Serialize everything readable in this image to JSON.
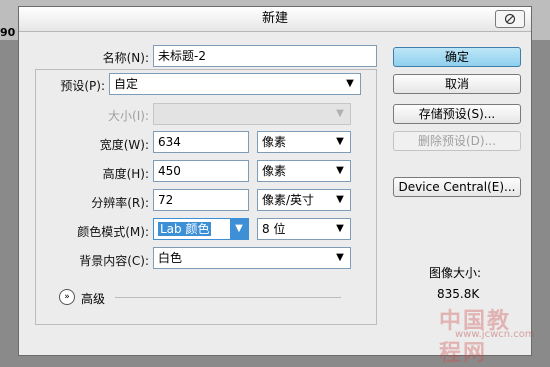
{
  "background": {
    "ruler_number": "90"
  },
  "dialog": {
    "title": "新建",
    "title_button_icon": "no-entry-icon",
    "name": {
      "label": "名称(N):",
      "value": "未标题-2"
    },
    "preset": {
      "label": "预设(P):",
      "value": "自定"
    },
    "size": {
      "label": "大小(I):",
      "value": ""
    },
    "width": {
      "label": "宽度(W):",
      "value": "634",
      "unit": "像素"
    },
    "height": {
      "label": "高度(H):",
      "value": "450",
      "unit": "像素"
    },
    "resolution": {
      "label": "分辨率(R):",
      "value": "72",
      "unit": "像素/英寸"
    },
    "color_mode": {
      "label": "颜色模式(M):",
      "value": "Lab 颜色",
      "bits": "8 位"
    },
    "background_contents": {
      "label": "背景内容(C):",
      "value": "白色"
    },
    "advanced_label": "高级",
    "buttons": {
      "ok": "确定",
      "cancel": "取消",
      "save_preset": "存储预设(S)...",
      "delete_preset": "删除预设(D)...",
      "device_central": "Device Central(E)..."
    },
    "image_size_label": "图像大小:",
    "image_size_value": "835.8K"
  },
  "watermark": {
    "text": "中国教程网",
    "url": "www.jcwcn.com"
  },
  "colors": {
    "accent": "#3d8fd6",
    "primary_button": "#8fd0ee",
    "dialog_bg": "#ececec"
  }
}
